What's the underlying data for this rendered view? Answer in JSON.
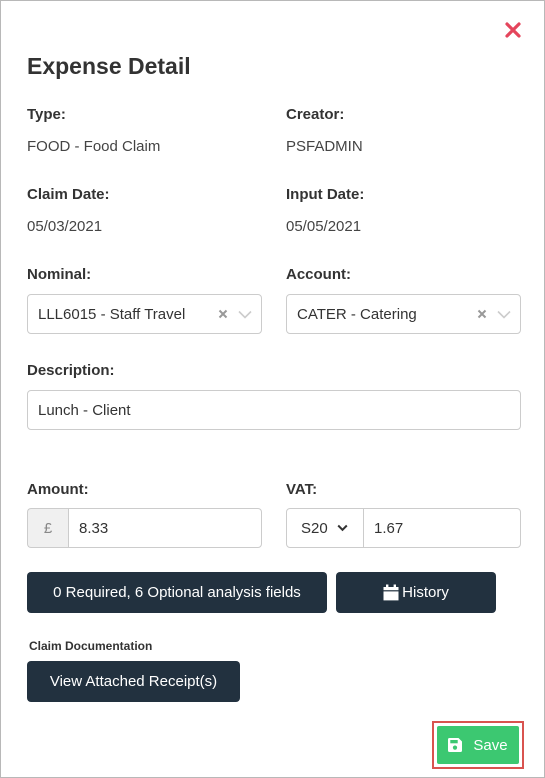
{
  "colors": {
    "close": "#e4455c",
    "button": "#22313f",
    "save": "#3cc871",
    "highlight": "#d9534f"
  },
  "header": {
    "title": "Expense Detail",
    "close_icon": "close-icon"
  },
  "type": {
    "label": "Type:",
    "value": "FOOD - Food Claim"
  },
  "creator": {
    "label": "Creator:",
    "value": "PSFADMIN"
  },
  "claim_date": {
    "label": "Claim Date:",
    "value": "05/03/2021"
  },
  "input_date": {
    "label": "Input Date:",
    "value": "05/05/2021"
  },
  "nominal": {
    "label": "Nominal:",
    "value": "LLL6015 - Staff Travel"
  },
  "account": {
    "label": "Account:",
    "value": "CATER - Catering"
  },
  "description": {
    "label": "Description:",
    "value": "Lunch - Client"
  },
  "amount": {
    "label": "Amount:",
    "currency": "£",
    "value": "8.33"
  },
  "vat": {
    "label": "VAT:",
    "code": "S20",
    "value": "1.67"
  },
  "buttons": {
    "analysis": "0 Required, 6 Optional analysis fields",
    "history": "History",
    "receipts": "View Attached Receipt(s)",
    "save": "Save"
  },
  "documentation": {
    "label": "Claim Documentation"
  }
}
